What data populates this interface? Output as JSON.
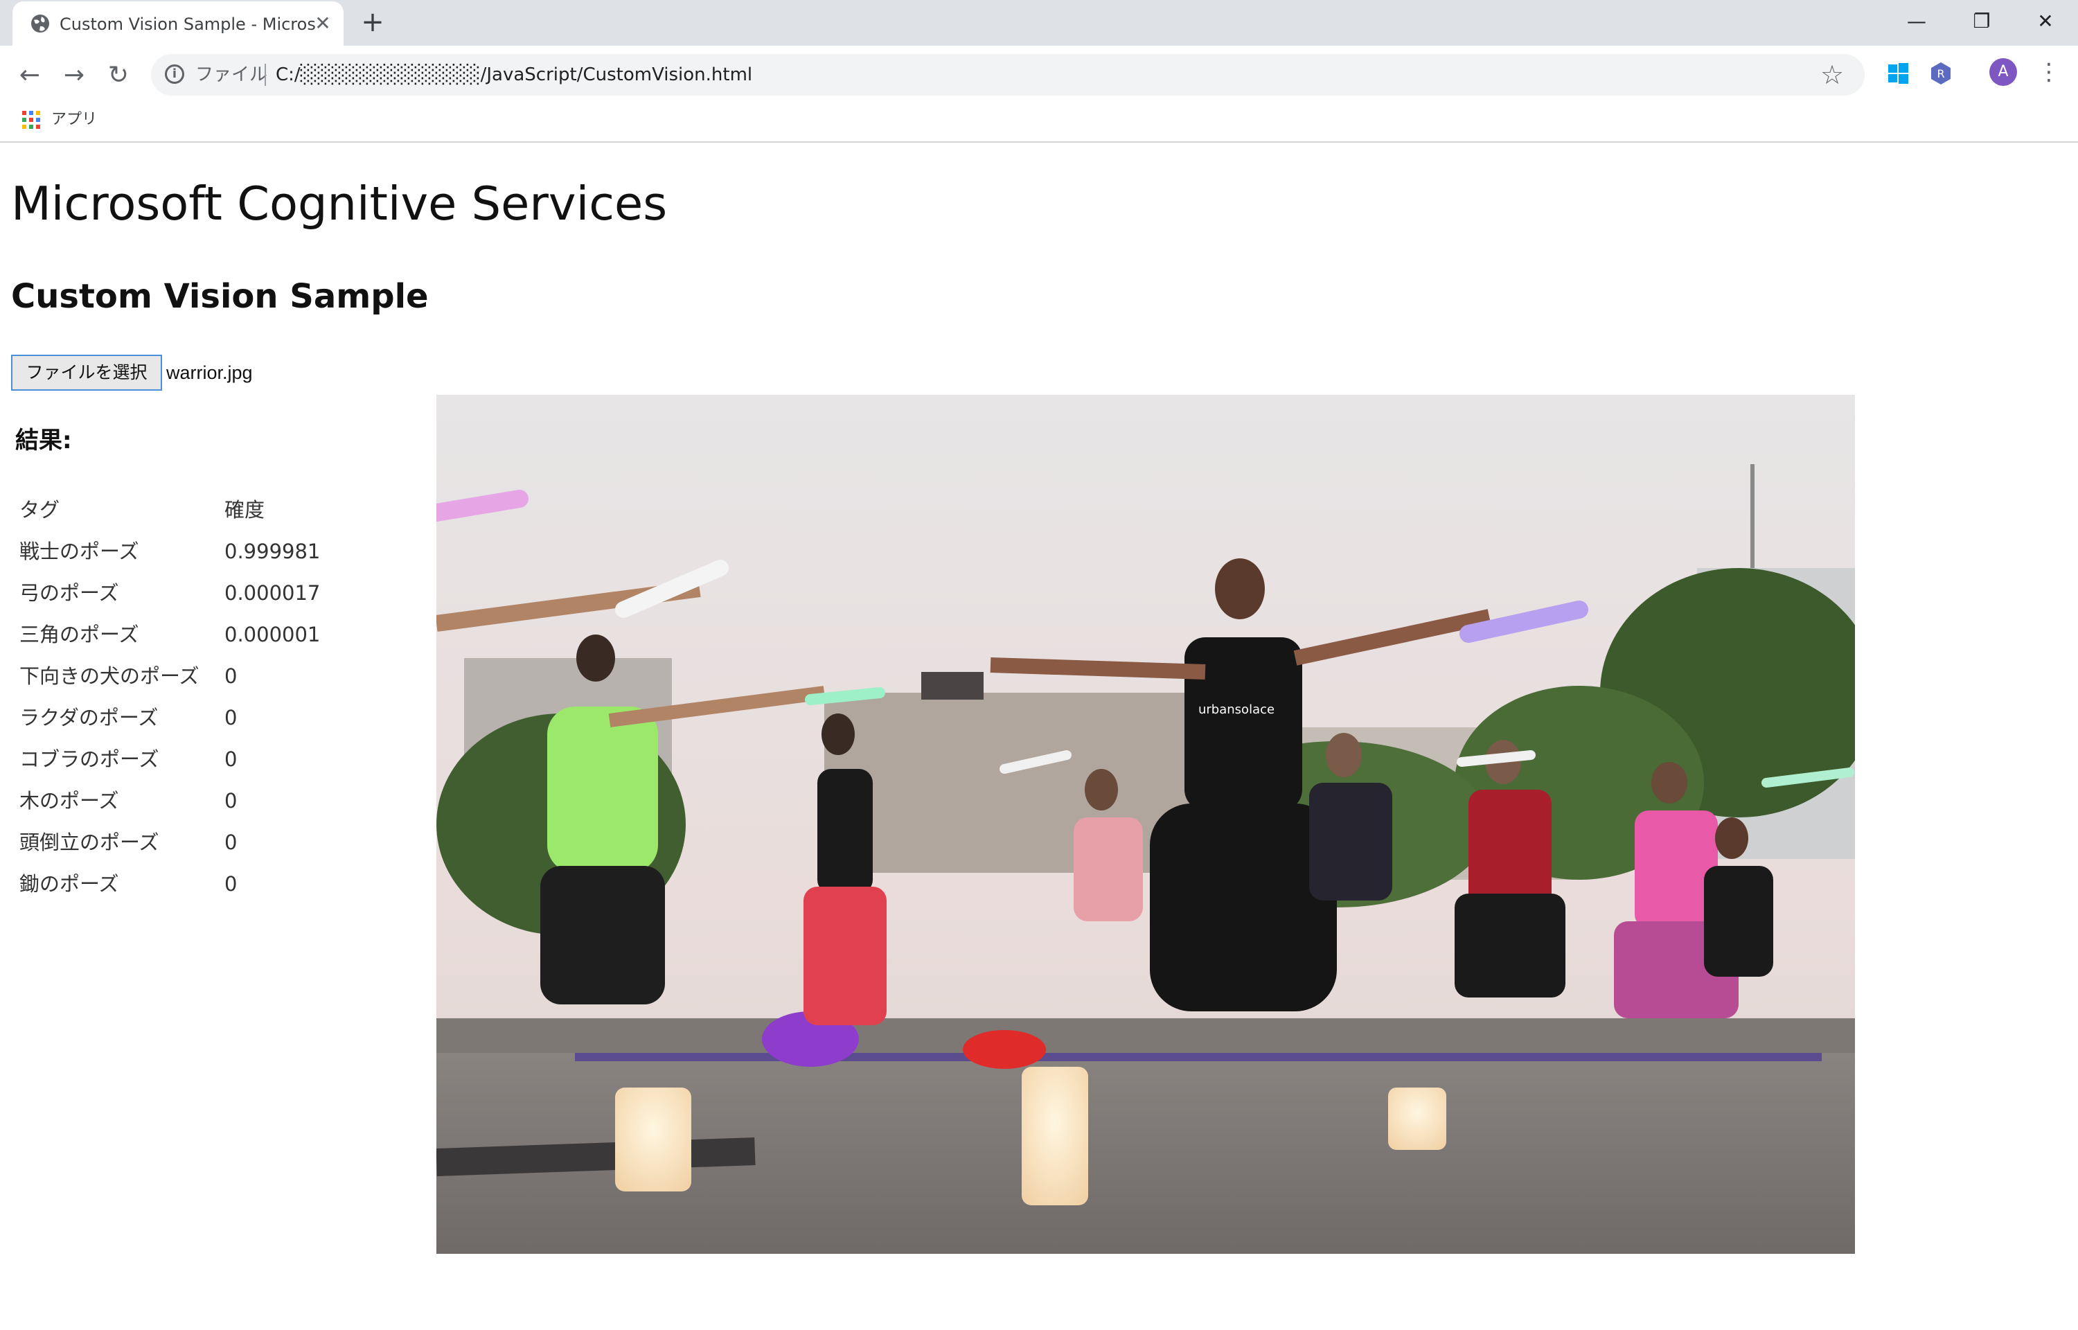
{
  "browser": {
    "tab_title": "Custom Vision Sample - Microsoft",
    "tab_close": "✕",
    "new_tab": "+",
    "win_minimize": "—",
    "win_restore": "❐",
    "win_close": "✕",
    "url_prefix": "ファイル",
    "url": "C:/░░░░░░░░░░░░░/JavaScript/CustomVision.html",
    "bookmark_apps": "アプリ",
    "avatar_letter": "A"
  },
  "page": {
    "title": "Microsoft Cognitive Services",
    "subtitle": "Custom Vision Sample",
    "file_button": "ファイルを選択",
    "file_name": "warrior.jpg",
    "results_heading": "結果:"
  },
  "results": {
    "header": {
      "tag": "タグ",
      "confidence": "確度"
    },
    "rows": [
      {
        "tag": "戦士のポーズ",
        "confidence": "0.999981"
      },
      {
        "tag": "弓のポーズ",
        "confidence": "0.000017"
      },
      {
        "tag": "三角のポーズ",
        "confidence": "0.000001"
      },
      {
        "tag": "下向きの犬のポーズ",
        "confidence": "0"
      },
      {
        "tag": "ラクダのポーズ",
        "confidence": "0"
      },
      {
        "tag": "コブラのポーズ",
        "confidence": "0"
      },
      {
        "tag": "木のポーズ",
        "confidence": "0"
      },
      {
        "tag": "頭倒立のポーズ",
        "confidence": "0"
      },
      {
        "tag": "鋤のポーズ",
        "confidence": "0"
      }
    ]
  },
  "photo": {
    "shirt_text": "urbansolace",
    "scene": "yoga-warrior-pose-class"
  },
  "colors": {
    "tabstrip": "#dee1e6",
    "omnibox": "#f1f3f4",
    "file_button_border": "#4a90d9",
    "avatar": "#7e57c2"
  }
}
